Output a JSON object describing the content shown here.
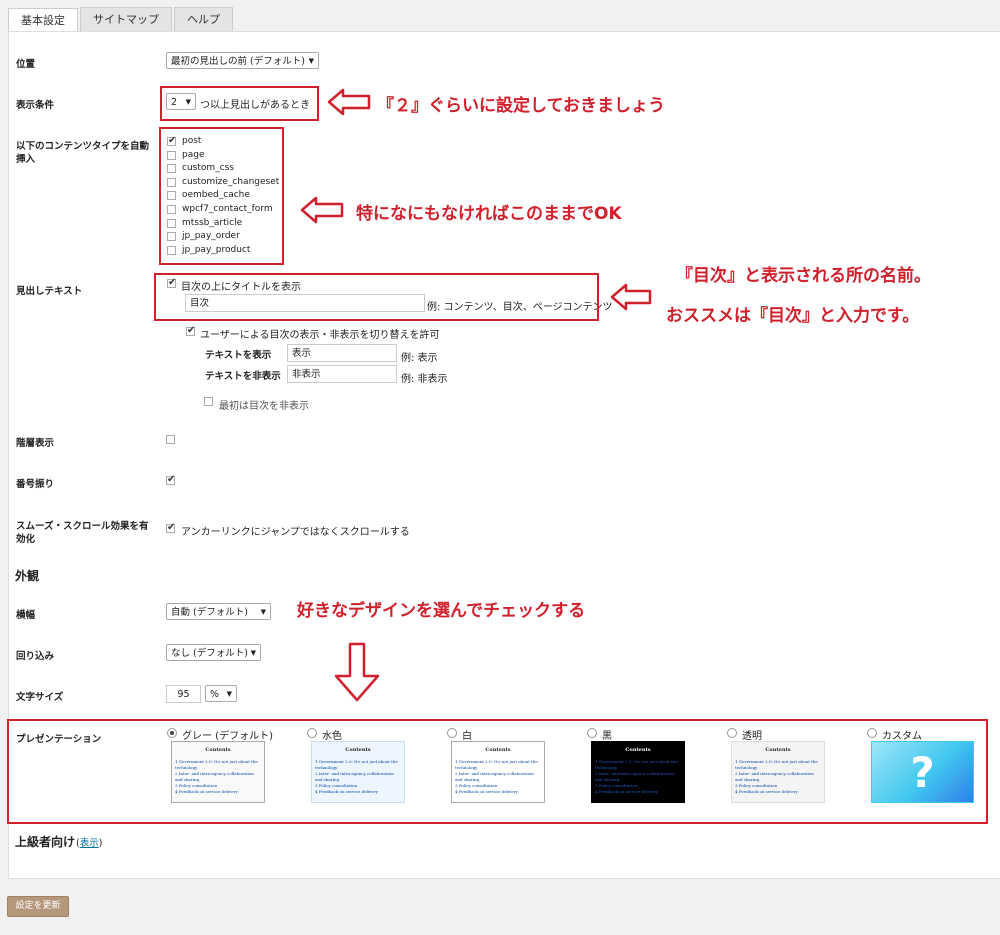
{
  "tabs": [
    "基本設定",
    "サイトマップ",
    "ヘルプ"
  ],
  "position": {
    "label": "位置",
    "value": "最初の見出しの前 (デフォルト)"
  },
  "display_condition": {
    "label": "表示条件",
    "count": "2",
    "suffix": "つ以上見出しがあるとき"
  },
  "auto_insert": {
    "label_line1": "以下のコンテンツタイプを自動",
    "label_line2": "挿入",
    "items": [
      {
        "name": "post",
        "checked": true
      },
      {
        "name": "page",
        "checked": false
      },
      {
        "name": "custom_css",
        "checked": false
      },
      {
        "name": "customize_changeset",
        "checked": false
      },
      {
        "name": "oembed_cache",
        "checked": false
      },
      {
        "name": "wpcf7_contact_form",
        "checked": false
      },
      {
        "name": "mtssb_article",
        "checked": false
      },
      {
        "name": "jp_pay_order",
        "checked": false
      },
      {
        "name": "jp_pay_product",
        "checked": false
      }
    ]
  },
  "heading_text": {
    "label": "見出しテキスト",
    "show_title_label": "目次の上にタイトルを表示",
    "title_value": "目次",
    "title_example": "例: コンテンツ、目次、ページコンテンツ",
    "allow_toggle_label": "ユーザーによる目次の表示・非表示を切り替えを許可",
    "show_text_label": "テキストを表示",
    "show_text_value": "表示",
    "show_text_example": "例: 表示",
    "hide_text_label": "テキストを非表示",
    "hide_text_value": "非表示",
    "hide_text_example": "例: 非表示",
    "initially_hide_label": "最初は目次を非表示"
  },
  "hierarchy": {
    "label": "階層表示"
  },
  "numbering": {
    "label": "番号振り"
  },
  "smooth_scroll": {
    "label_line1": "スムーズ・スクロール効果を有",
    "label_line2": "効化",
    "option": "アンカーリンクにジャンプではなくスクロールする"
  },
  "appearance": {
    "heading": "外観",
    "width_label": "横幅",
    "width_value": "自動 (デフォルト)",
    "wrap_label": "回り込み",
    "wrap_value": "なし (デフォルト)",
    "font_size_label": "文字サイズ",
    "font_size_value": "95",
    "font_size_unit": "%",
    "presentation_label": "プレゼンテーション",
    "presentations": [
      {
        "label": "グレー (デフォルト)",
        "selected": true,
        "bg": "#f9f9f9",
        "border": "#aaaaaa",
        "title_color": "#222222",
        "link_color": "#0645ad"
      },
      {
        "label": "水色",
        "selected": false,
        "bg": "#edf6ff",
        "border": "#c9dff5",
        "title_color": "#222222",
        "link_color": "#0645ad"
      },
      {
        "label": "白",
        "selected": false,
        "bg": "#ffffff",
        "border": "#aaaaaa",
        "title_color": "#222222",
        "link_color": "#0645ad"
      },
      {
        "label": "黒",
        "selected": false,
        "bg": "#000000",
        "border": "#000000",
        "title_color": "#ffffff",
        "link_color": "#2a56c6"
      },
      {
        "label": "透明",
        "selected": false,
        "bg": "#f4f4f4",
        "border": "#dddddd",
        "title_color": "#222222",
        "link_color": "#0645ad"
      },
      {
        "label": "カスタム",
        "selected": false,
        "bg": "#42c8f0",
        "border": "#42c8f0",
        "title_color": "#ffffff",
        "link_color": "#ffffff"
      }
    ],
    "sample_title": "Contents",
    "sample_lines": [
      "1 Government 2.0: It's not just about the",
      "technology",
      "2 Inter- and intra-agency collaboration",
      "and sharing",
      "3 Policy consultation",
      "4 Feedback on service delivery"
    ],
    "custom_mark": "?"
  },
  "advanced": {
    "heading": "上級者向け",
    "link": "表示"
  },
  "update_button": "設定を更新",
  "annotations": {
    "a1": "『２』ぐらいに設定しておきましょう",
    "a2": "特になにもなければこのままでOK",
    "a3": "『目次』と表示される所の名前。",
    "a4": "おススメは『目次』と入力です。",
    "a5": "好きなデザインを選んでチェックする"
  },
  "colors": {
    "annotation_red": "#d0202c",
    "button_bg": "#b5977b"
  }
}
